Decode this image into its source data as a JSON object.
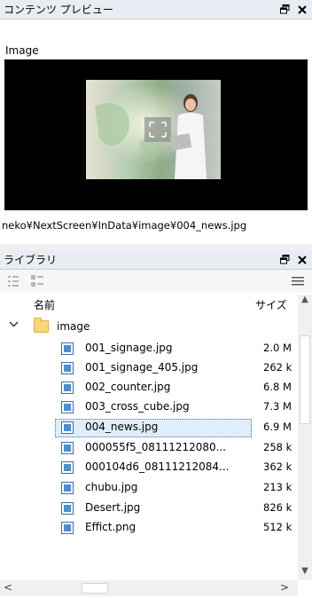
{
  "preview_panel": {
    "title": "コンテンツ プレビュー",
    "type_label": "Image",
    "file_path": "neko¥NextScreen¥InData¥image¥004_news.jpg"
  },
  "library_panel": {
    "title": "ライブラリ",
    "columns": {
      "name": "名前",
      "size": "サイズ"
    },
    "folder": "image",
    "files": [
      {
        "name": "001_signage.jpg",
        "size": "2.0 M"
      },
      {
        "name": "001_signage_405.jpg",
        "size": "262 k"
      },
      {
        "name": "002_counter.jpg",
        "size": "6.8 M"
      },
      {
        "name": "003_cross_cube.jpg",
        "size": "7.3 M"
      },
      {
        "name": "004_news.jpg",
        "size": "6.9 M"
      },
      {
        "name": "000055f5_08111212080...",
        "size": "258 k"
      },
      {
        "name": "000104d6_08111212084...",
        "size": "362 k"
      },
      {
        "name": "chubu.jpg",
        "size": "213 k"
      },
      {
        "name": "Desert.jpg",
        "size": "826 k"
      },
      {
        "name": "Effict.png",
        "size": "512 k"
      }
    ],
    "selected_index": 4
  }
}
